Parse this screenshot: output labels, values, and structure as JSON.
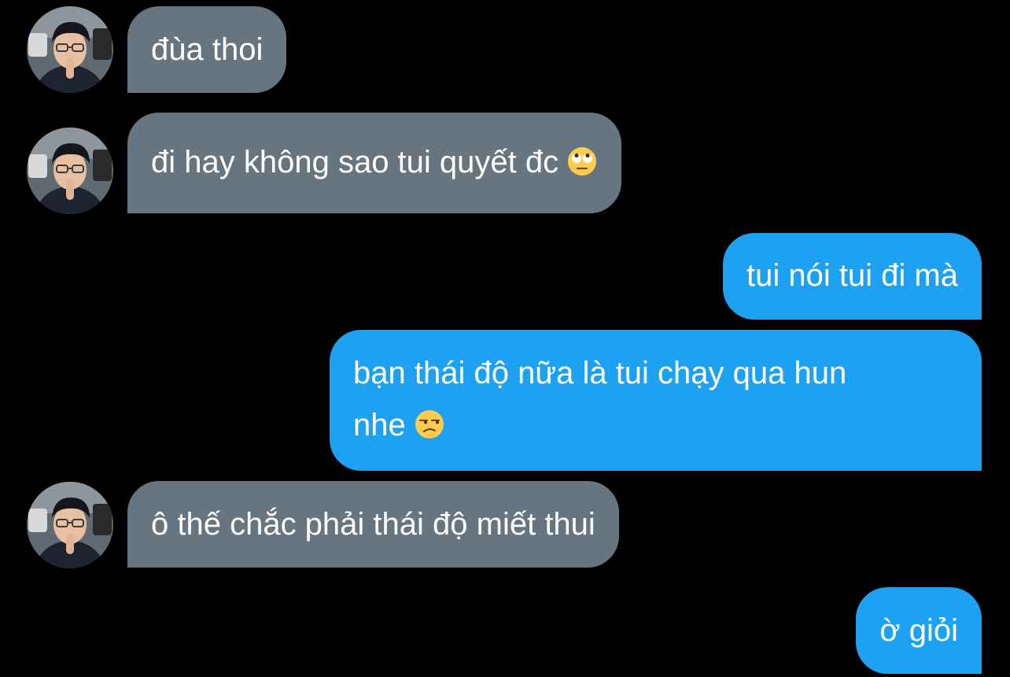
{
  "messages": [
    {
      "id": "m1",
      "direction": "incoming",
      "text": "đùa thoi"
    },
    {
      "id": "m2",
      "direction": "incoming",
      "text": "đi hay không sao tui quyết đc",
      "emoji": "face-with-rolling-eyes-icon"
    },
    {
      "id": "m3",
      "direction": "outgoing",
      "text": "tui nói tui đi mà"
    },
    {
      "id": "m4",
      "direction": "outgoing",
      "text_line1": "bạn thái độ nữa là tui chạy qua hun",
      "text_line2": "nhe",
      "emoji": "unamused-face-icon"
    },
    {
      "id": "m5",
      "direction": "incoming",
      "text": "ô thế chắc phải thái độ miết thui"
    },
    {
      "id": "m6",
      "direction": "outgoing",
      "text": "ờ giỏi"
    }
  ],
  "colors": {
    "background": "#000000",
    "incoming_bubble": "#66757f",
    "outgoing_bubble": "#1da1f2",
    "text": "#ffffff"
  }
}
